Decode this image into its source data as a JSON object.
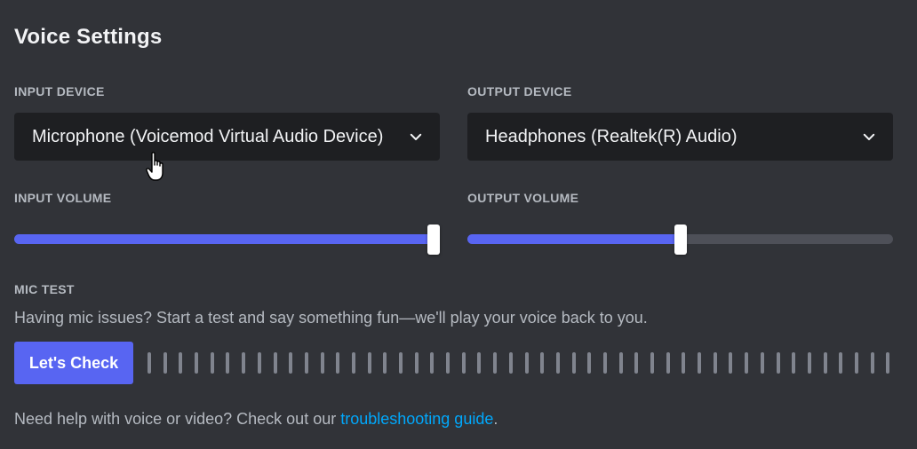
{
  "header": {
    "title": "Voice Settings"
  },
  "input_device": {
    "label": "INPUT DEVICE",
    "selected": "Microphone (Voicemod Virtual Audio Device)"
  },
  "output_device": {
    "label": "OUTPUT DEVICE",
    "selected": "Headphones (Realtek(R) Audio)"
  },
  "input_volume": {
    "label": "INPUT VOLUME",
    "value_percent": 100
  },
  "output_volume": {
    "label": "OUTPUT VOLUME",
    "value_percent": 50
  },
  "mic_test": {
    "label": "MIC TEST",
    "description": "Having mic issues? Start a test and say something fun—we'll play your voice back to you.",
    "button_label": "Let's Check",
    "meter_bar_count": 48
  },
  "help": {
    "prefix": "Need help with voice or video? Check out our ",
    "link_text": "troubleshooting guide",
    "suffix": "."
  },
  "colors": {
    "background": "#313338",
    "select_bg": "#1e1f22",
    "accent": "#5865f2",
    "link": "#00a8fc",
    "track": "#4e5058"
  },
  "icons": [
    "chevron-down-icon",
    "hand-pointer-cursor-icon"
  ]
}
